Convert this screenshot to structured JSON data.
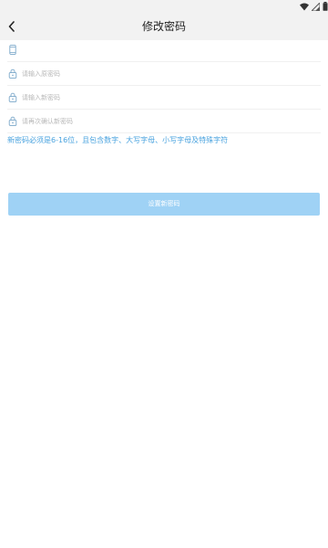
{
  "header": {
    "title": "修改密码"
  },
  "form": {
    "phone": {
      "value": "",
      "placeholder": ""
    },
    "old_password": {
      "placeholder": "请输入原密码"
    },
    "new_password": {
      "placeholder": "请输入新密码"
    },
    "confirm_password": {
      "placeholder": "请再次确认新密码"
    }
  },
  "hint": "新密码必须是6-16位，且包含数字、大写字母、小写字母及特殊字符",
  "submit_label": "设置新密码",
  "colors": {
    "accent": "#4aa3df",
    "button_bg": "#9fd2f5",
    "header_bg": "#f2f2f2"
  }
}
